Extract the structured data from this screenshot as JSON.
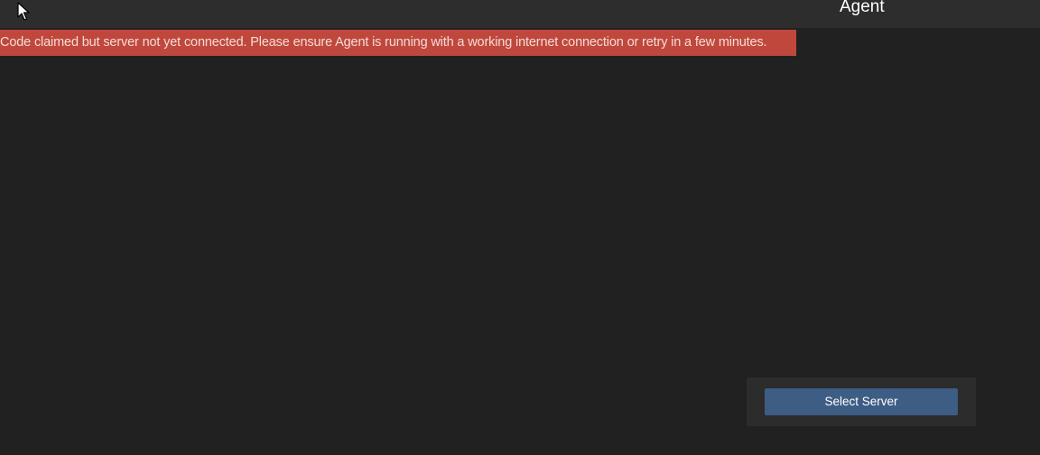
{
  "header": {
    "title": "Agent"
  },
  "cursor": {
    "icon": "mouse-pointer-icon"
  },
  "banner": {
    "message": "Code claimed but server not yet connected. Please ensure Agent is running with a working internet connection or retry in a few minutes.",
    "color": "#c0473c"
  },
  "server_panel": {
    "select_button_label": "Select Server",
    "button_color": "#3d5d85"
  },
  "colors": {
    "background": "#212121",
    "topbar": "#2d2d2d",
    "panel": "#2c2c2c"
  }
}
